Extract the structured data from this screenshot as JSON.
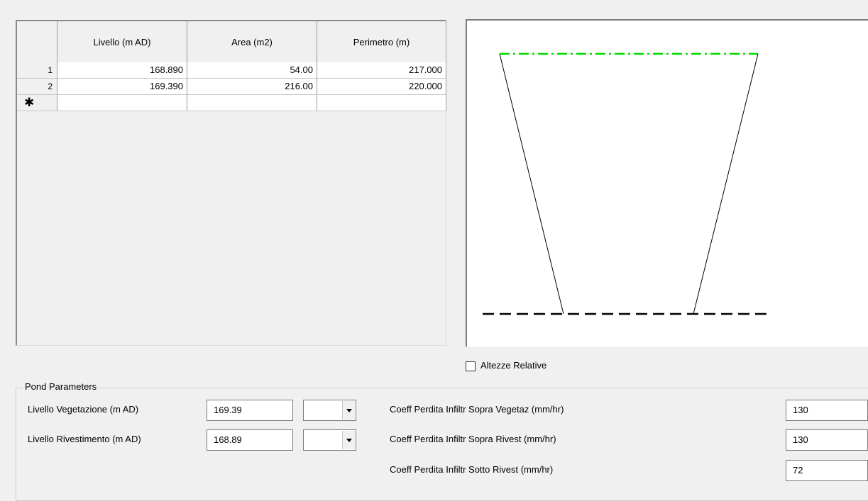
{
  "grid": {
    "columns": [
      "Livello (m AD)",
      "Area (m2)",
      "Perimetro (m)"
    ],
    "rows": [
      {
        "num": "1",
        "livello": "168.890",
        "area": "54.00",
        "perimetro": "217.000"
      },
      {
        "num": "2",
        "livello": "169.390",
        "area": "216.00",
        "perimetro": "220.000"
      }
    ],
    "new_row_marker": "✱"
  },
  "drawing": {
    "top_line_color": "#00dd00",
    "base_line_color": "#000000"
  },
  "altezze_relative": {
    "label": "Altezze Relative",
    "checked": false
  },
  "pond_parameters": {
    "title": "Pond Parameters",
    "livello_vegetazione": {
      "label": "Livello Vegetazione (m AD)",
      "value": "169.39"
    },
    "livello_rivestimento": {
      "label": "Livello Rivestimento (m AD)",
      "value": "168.89"
    },
    "coeff_sopra_vegetaz": {
      "label": "Coeff Perdita Infiltr Sopra Vegetaz (mm/hr)",
      "value": "130"
    },
    "coeff_sopra_rivest": {
      "label": "Coeff Perdita Infiltr Sopra Rivest (mm/hr)",
      "value": "130"
    },
    "coeff_sotto_rivest": {
      "label": "Coeff Perdita Infiltr Sotto Rivest (mm/hr)",
      "value": "72"
    }
  }
}
